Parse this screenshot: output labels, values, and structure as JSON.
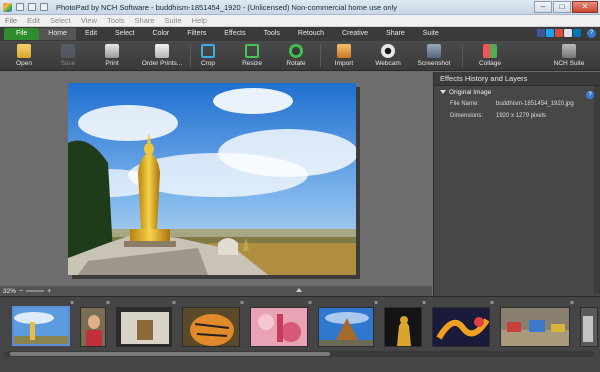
{
  "titlebar": {
    "title": "PhotoPad by NCH Software - buddhism-1851454_1920 - (Unlicensed) Non-commercial home use only",
    "minimize": "–",
    "maximize": "□",
    "close": "✕"
  },
  "menu": [
    "File",
    "Edit",
    "Select",
    "View",
    "Tools",
    "Share",
    "Suite",
    "Help"
  ],
  "ribbon_tabs": [
    "File",
    "Home",
    "Edit",
    "Select",
    "Color",
    "Filters",
    "Effects",
    "Tools",
    "Retouch",
    "Creative",
    "Share",
    "Suite"
  ],
  "help_label": "?",
  "toolbar": [
    {
      "label": "Open",
      "icon": "open-folder-icon"
    },
    {
      "label": "Save",
      "icon": "save-disk-icon"
    },
    {
      "label": "Print",
      "icon": "printer-icon"
    },
    {
      "label": "Order Prints...",
      "icon": "order-prints-icon"
    },
    {
      "label": "Crop",
      "icon": "crop-icon"
    },
    {
      "label": "Resize",
      "icon": "resize-icon"
    },
    {
      "label": "Rotate",
      "icon": "rotate-icon"
    },
    {
      "label": "Import",
      "icon": "import-icon"
    },
    {
      "label": "Webcam",
      "icon": "webcam-icon"
    },
    {
      "label": "Screenshot",
      "icon": "screenshot-icon"
    },
    {
      "label": "Collage",
      "icon": "collage-icon"
    },
    {
      "label": "NCH Suite",
      "icon": "nch-suite-icon"
    }
  ],
  "panel": {
    "title": "Effects History and Layers",
    "layer": "Original Image",
    "info_label": "?",
    "props": [
      {
        "key": "File Name:",
        "value": "buddhism-1851454_1920.jpg"
      },
      {
        "key": "Dimensions:",
        "value": "1920 x 1279 pixels"
      }
    ]
  },
  "zoom": {
    "value": "32%",
    "minus": "−",
    "plus": "+"
  },
  "thumbnails": [
    {
      "name": "buddha-statue",
      "selected": true
    },
    {
      "name": "child-portrait",
      "selected": false
    },
    {
      "name": "temple-room",
      "selected": false
    },
    {
      "name": "tiger",
      "selected": false
    },
    {
      "name": "pink-flowers",
      "selected": false
    },
    {
      "name": "temple-sky",
      "selected": false
    },
    {
      "name": "golden-buddha-dark",
      "selected": false
    },
    {
      "name": "dragon-lights",
      "selected": false
    },
    {
      "name": "market",
      "selected": false
    },
    {
      "name": "partial",
      "selected": false
    }
  ],
  "thumb_close": "×",
  "colors": {
    "file_tab": "#2f8c2f",
    "selection": "#5b8ed8",
    "accent_blue": "#3c7cd0"
  }
}
